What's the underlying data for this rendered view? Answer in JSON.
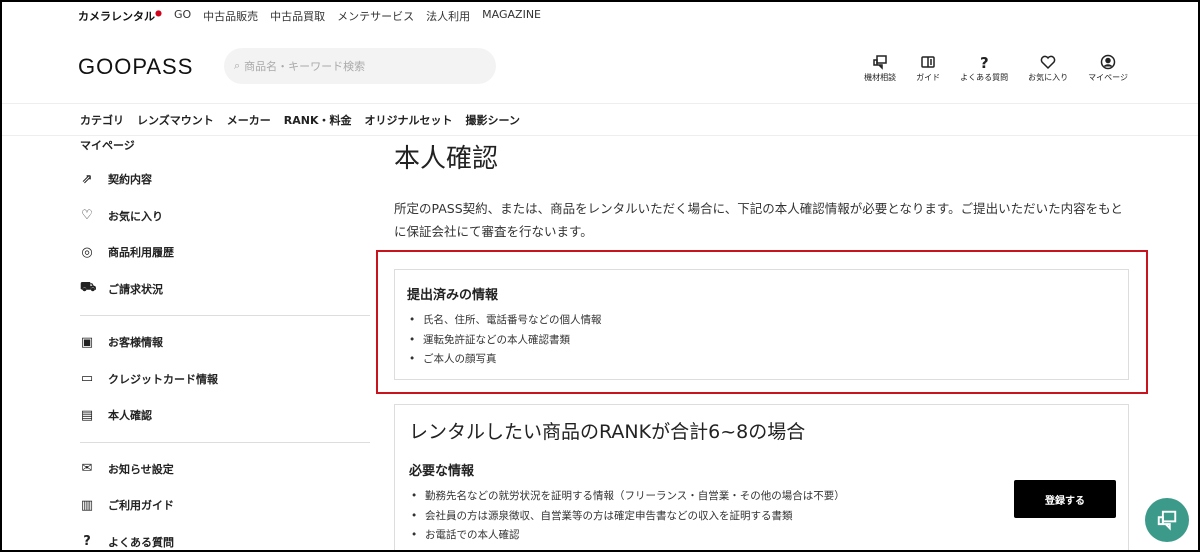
{
  "topnav": {
    "brand": "カメラレンタル",
    "items": [
      "GO",
      "中古品販売",
      "中古品買取",
      "メンテサービス",
      "法人利用",
      "MAGAZINE"
    ]
  },
  "header": {
    "logo": "GOOPASS",
    "search_placeholder": "商品名・キーワード検索",
    "icons": [
      {
        "icon": "chat-icon",
        "label": "機材相談"
      },
      {
        "icon": "guide-icon",
        "label": "ガイド"
      },
      {
        "icon": "question-icon",
        "label": "よくある質問"
      },
      {
        "icon": "heart-icon",
        "label": "お気に入り"
      },
      {
        "icon": "user-icon",
        "label": "マイページ"
      }
    ]
  },
  "catnav": [
    "カテゴリ",
    "レンズマウント",
    "メーカー",
    "RANK・料金",
    "オリジナルセット",
    "撮影シーン"
  ],
  "sidebar": {
    "title": "マイページ",
    "groups": [
      [
        {
          "icon": "contract-icon",
          "glyph": "⇗",
          "label": "契約内容"
        },
        {
          "icon": "heart-icon",
          "glyph": "♡",
          "label": "お気に入り"
        },
        {
          "icon": "camera-history-icon",
          "glyph": "◎",
          "label": "商品利用履歴"
        },
        {
          "icon": "cart-icon",
          "glyph": "⛟",
          "label": "ご請求状況"
        }
      ],
      [
        {
          "icon": "id-badge-icon",
          "glyph": "▣",
          "label": "お客様情報"
        },
        {
          "icon": "credit-card-icon",
          "glyph": "▭",
          "label": "クレジットカード情報"
        },
        {
          "icon": "id-card-icon",
          "glyph": "▤",
          "label": "本人確認"
        }
      ],
      [
        {
          "icon": "mail-icon",
          "glyph": "✉",
          "label": "お知らせ設定"
        },
        {
          "icon": "guide-icon",
          "glyph": "▥",
          "label": "ご利用ガイド"
        },
        {
          "icon": "question-icon",
          "glyph": "?",
          "label": "よくある質問"
        }
      ]
    ]
  },
  "main": {
    "title": "本人確認",
    "description": "所定のPASS契約、または、商品をレンタルいただく場合に、下記の本人確認情報が必要となります。ご提出いただいた内容をもとに保証会社にて審査を行ないます。",
    "submitted": {
      "heading": "提出済みの情報",
      "items": [
        "氏名、住所、電話番号などの個人情報",
        "運転免許証などの本人確認書類",
        "ご本人の顔写真"
      ]
    },
    "rank": {
      "heading": "レンタルしたい商品のRANKが合計6~8の場合",
      "sub": "必要な情報",
      "items": [
        "勤務先名などの就労状況を証明する情報（フリーランス・自営業・その他の場合は不要）",
        "会社員の方は源泉徴収、自営業等の方は確定申告書などの収入を証明する書類",
        "お電話での本人確認"
      ],
      "button": "登録する"
    }
  },
  "colors": {
    "highlight": "#c8141e",
    "chat": "#3b9a8a"
  }
}
